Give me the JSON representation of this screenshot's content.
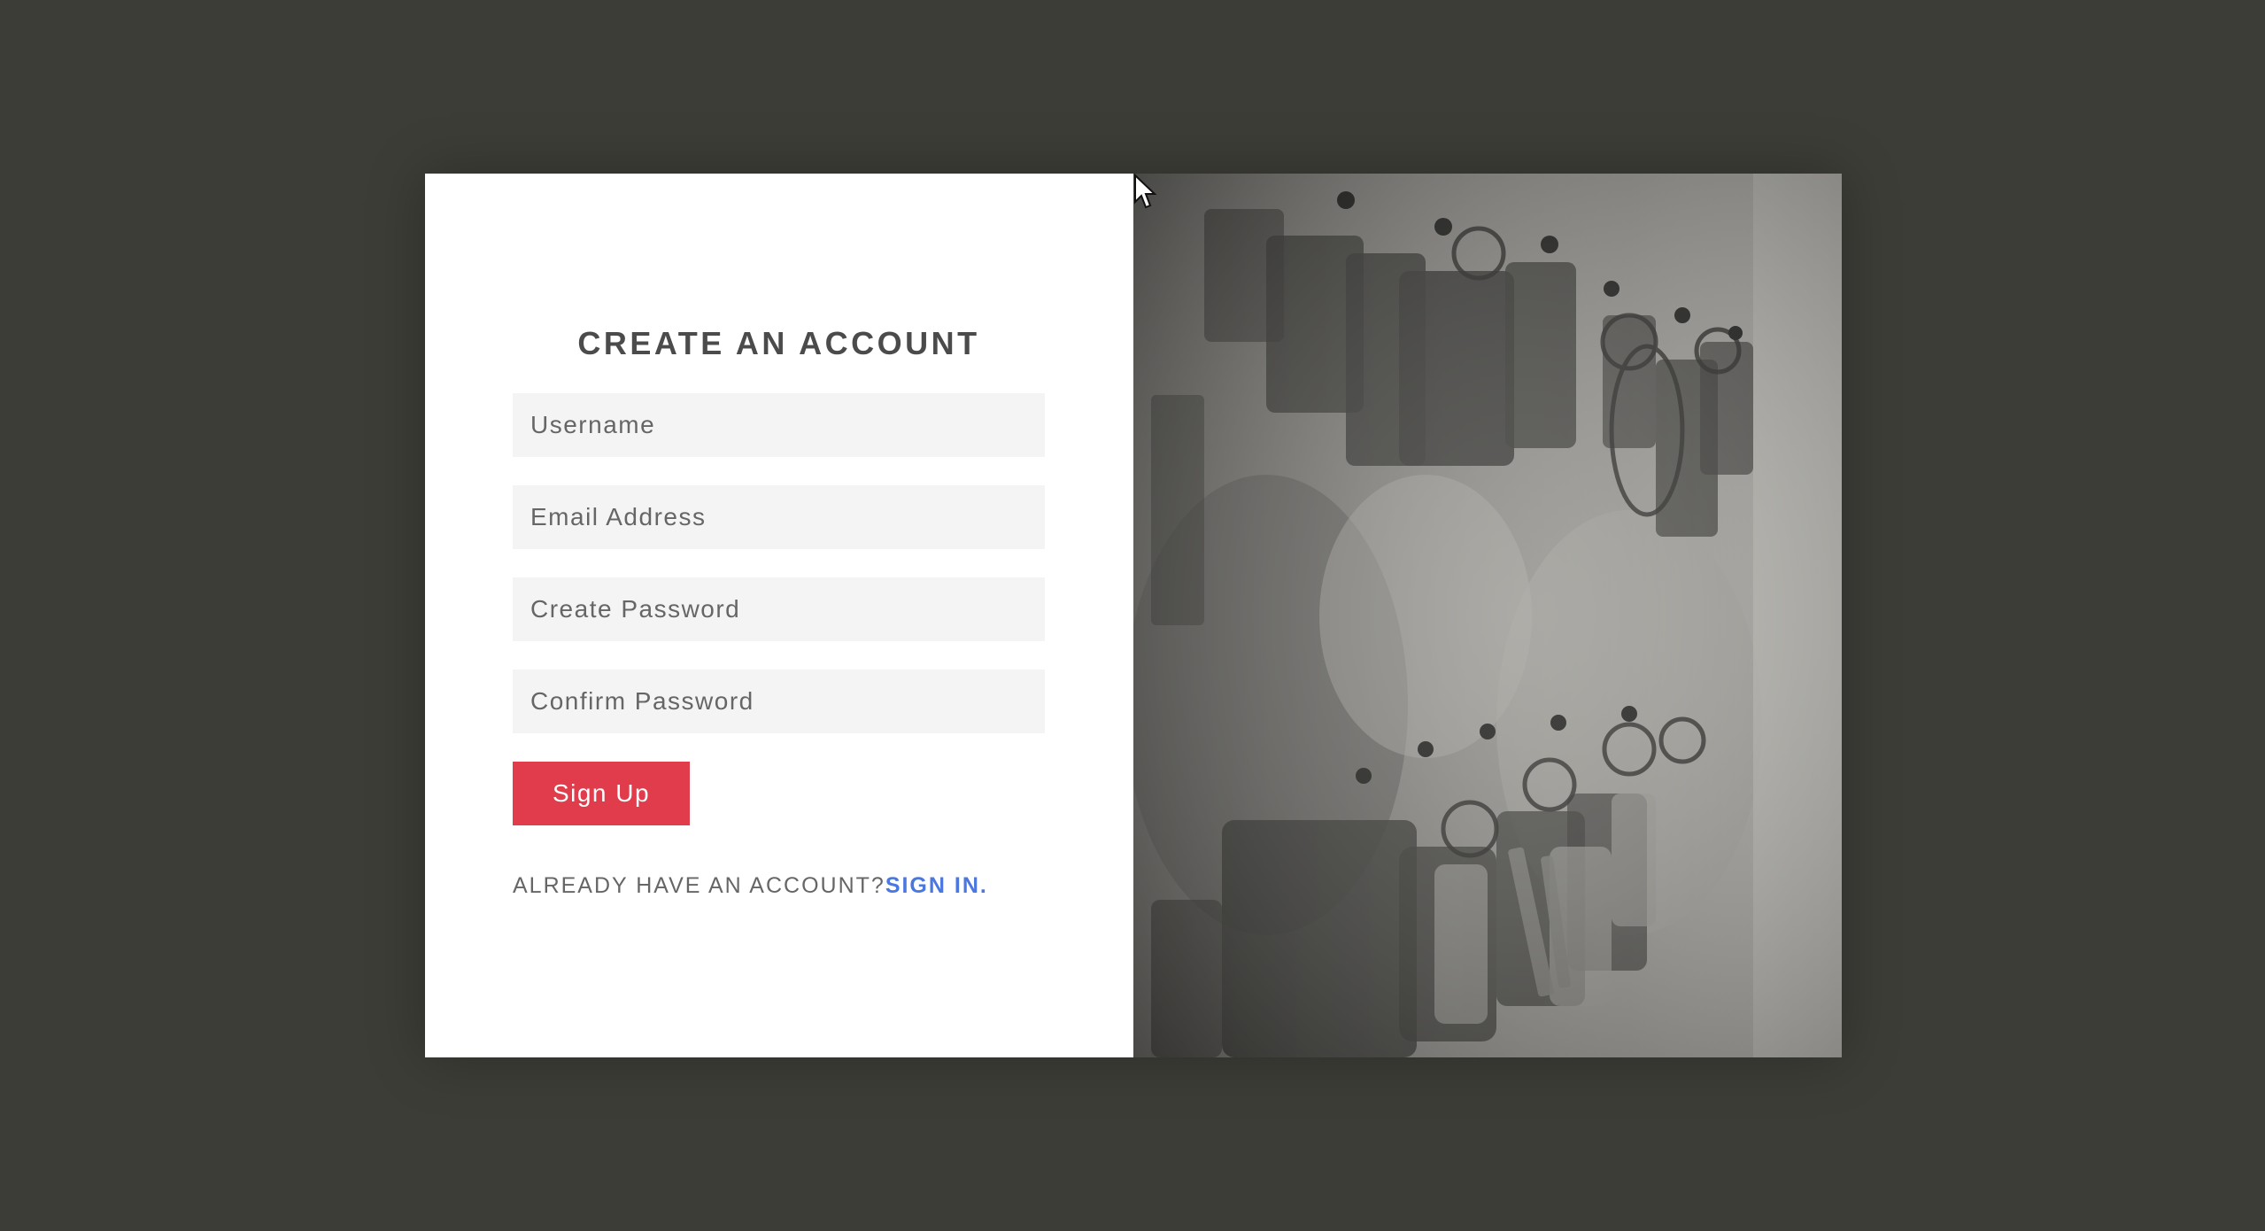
{
  "signup": {
    "title": "CREATE AN ACCOUNT",
    "fields": {
      "username_placeholder": "Username",
      "email_placeholder": "Email Address",
      "password_placeholder": "Create Password",
      "confirm_placeholder": "Confirm Password"
    },
    "button_label": "Sign Up",
    "already_text": "ALREADY HAVE AN ACCOUNT?",
    "signin_link": "SIGN IN."
  },
  "colors": {
    "backdrop": "#3c3d37",
    "button": "#e03c4c",
    "link": "#4a77e0",
    "field_bg": "#f4f4f4"
  },
  "image": {
    "description_icon": "keys-photo"
  }
}
